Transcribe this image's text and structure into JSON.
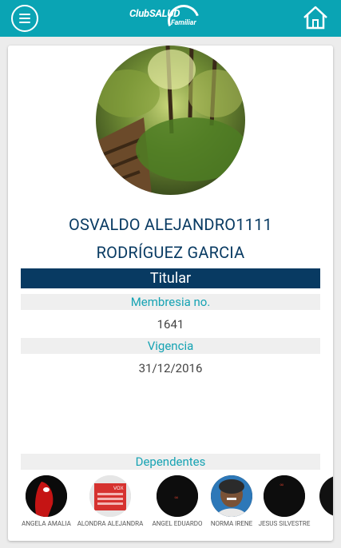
{
  "header": {
    "logo_text": "ClubSALUD",
    "logo_subtext": "Familiar"
  },
  "profile": {
    "name_line1": "OSVALDO ALEJANDRO1111",
    "name_line2": "RODRÍGUEZ GARCIA",
    "role": "Titular",
    "membership_label": "Membresia no.",
    "membership_value": "1641",
    "validity_label": "Vigencia",
    "validity_value": "31/12/2016"
  },
  "dependents": {
    "label": "Dependentes",
    "items": [
      {
        "name": "ANGELA AMALIA",
        "icon": "avatar-red-mask"
      },
      {
        "name": "ALONDRA ALEJANDRA",
        "icon": "avatar-red-box"
      },
      {
        "name": "ANGEL EDUARDO",
        "icon": "avatar-dark"
      },
      {
        "name": "NORMA IRENE",
        "icon": "avatar-woman"
      },
      {
        "name": "JESUS SILVESTRE",
        "icon": "avatar-dark"
      },
      {
        "name": "",
        "icon": "avatar-dark"
      }
    ]
  },
  "colors": {
    "header": "#0aa4b4",
    "navy": "#083a62",
    "teal_text": "#16a3b3"
  }
}
